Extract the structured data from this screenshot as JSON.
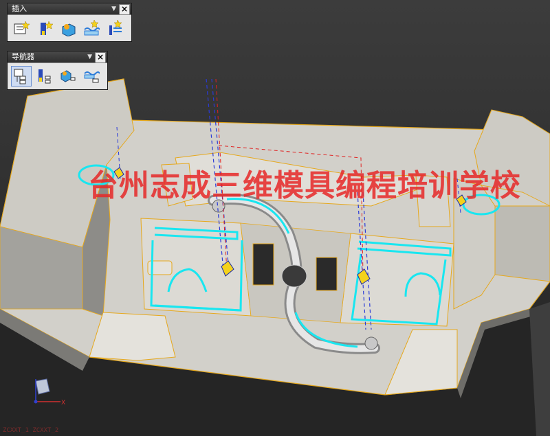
{
  "toolbars": {
    "insert": {
      "title": "插入",
      "buttons": [
        {
          "name": "create-program-icon"
        },
        {
          "name": "create-tool-icon"
        },
        {
          "name": "create-geometry-icon"
        },
        {
          "name": "create-method-icon"
        },
        {
          "name": "create-operation-icon"
        }
      ]
    },
    "navigator": {
      "title": "导航器",
      "buttons": [
        {
          "name": "program-order-view-icon",
          "active": true
        },
        {
          "name": "machine-tool-view-icon"
        },
        {
          "name": "geometry-view-icon"
        },
        {
          "name": "machining-method-view-icon"
        }
      ]
    }
  },
  "watermark": "台州志成三维模具编程培训学校",
  "axis_triad": {
    "label": "X"
  },
  "status_text": "ZCXXT_1   ZCXXT_2",
  "colors": {
    "background": "#2b2b2b",
    "part_face": "#d4d2cc",
    "edge": "#e6a81c",
    "toolpath": "#19e6f0",
    "watermark": "#e62828"
  }
}
